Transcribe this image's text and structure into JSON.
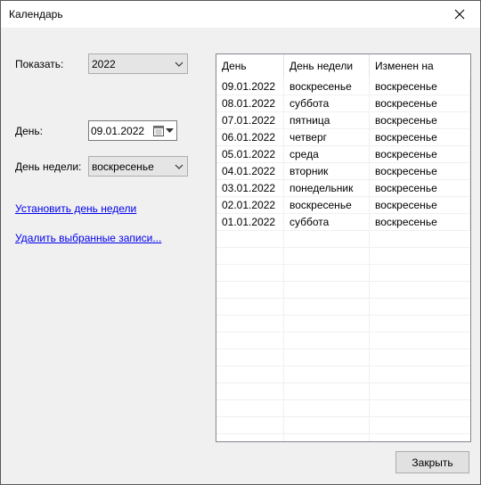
{
  "window": {
    "title": "Календарь"
  },
  "show": {
    "label": "Показать:",
    "value": "2022"
  },
  "day": {
    "label": "День:",
    "value": "09.01.2022"
  },
  "weekday": {
    "label": "День недели:",
    "value": "воскресенье"
  },
  "links": {
    "set_weekday": "Установить день недели",
    "delete_selected": "Удалить выбранные записи..."
  },
  "table": {
    "headers": [
      "День",
      "День недели",
      "Изменен на"
    ],
    "rows": [
      [
        "09.01.2022",
        "воскресенье",
        "воскресенье"
      ],
      [
        "08.01.2022",
        "суббота",
        "воскресенье"
      ],
      [
        "07.01.2022",
        "пятница",
        "воскресенье"
      ],
      [
        "06.01.2022",
        "четверг",
        "воскресенье"
      ],
      [
        "05.01.2022",
        "среда",
        "воскресенье"
      ],
      [
        "04.01.2022",
        "вторник",
        "воскресенье"
      ],
      [
        "03.01.2022",
        "понедельник",
        "воскресенье"
      ],
      [
        "02.01.2022",
        "воскресенье",
        "воскресенье"
      ],
      [
        "01.01.2022",
        "суббота",
        "воскресенье"
      ]
    ]
  },
  "buttons": {
    "close": "Закрыть"
  },
  "icons": {
    "close": "close-icon",
    "calendar": "calendar-icon",
    "dropdown": "chevron-down-icon"
  }
}
